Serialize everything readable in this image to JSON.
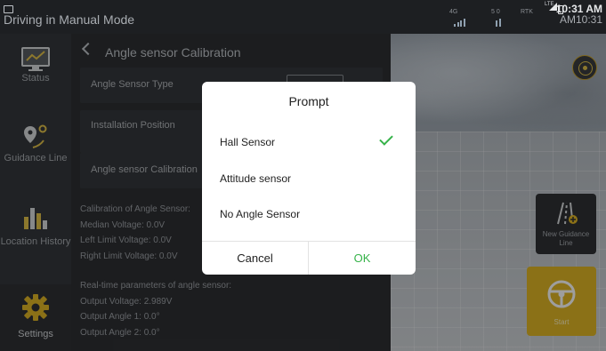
{
  "status_bar": {
    "title": "Driving in Manual Mode",
    "signals": [
      {
        "label": "4G"
      },
      {
        "label": "5 0"
      },
      {
        "label": "RTK"
      }
    ],
    "lte_label": "LTE",
    "time": "10:31 AM",
    "time_overlay": "AM10:31"
  },
  "sidebar": {
    "items": [
      {
        "label": "Status"
      },
      {
        "label": "Guidance Line"
      },
      {
        "label": "Location History"
      },
      {
        "label": "Settings"
      }
    ]
  },
  "panel": {
    "title": "Angle sensor Calibration",
    "rows": [
      {
        "label": "Angle Sensor Type"
      },
      {
        "label": "Installation Position"
      },
      {
        "label": "Angle sensor Calibration"
      }
    ],
    "calibration": {
      "heading": "Calibration of Angle Sensor:",
      "median": "Median Voltage: 0.0V",
      "left": "Left Limit Voltage: 0.0V",
      "right": "Right Limit Voltage: 0.0V"
    },
    "realtime": {
      "heading": "Real-time parameters of angle sensor:",
      "voltage": "Output Voltage: 2.989V",
      "angle1": "Output Angle 1: 0.0°",
      "angle2": "Output Angle 2: 0.0°"
    }
  },
  "map": {
    "new_guidance_label": "New Guidance Line",
    "start_label": "Start"
  },
  "dialog": {
    "title": "Prompt",
    "options": [
      {
        "label": "Hall Sensor",
        "selected": true
      },
      {
        "label": "Attitude sensor",
        "selected": false
      },
      {
        "label": "No Angle Sensor",
        "selected": false
      }
    ],
    "cancel_label": "Cancel",
    "ok_label": "OK"
  },
  "colors": {
    "accent_green": "#37b34a",
    "start_yellow": "#e0b626",
    "panel_bg": "#2e3033"
  }
}
